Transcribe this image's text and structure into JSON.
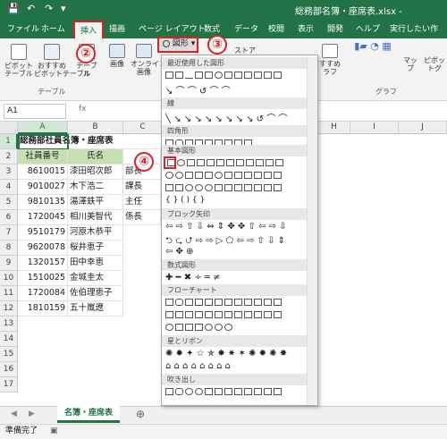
{
  "title_bar": {
    "title": "総務部名簿・座席表.xlsx - ",
    "save_icon": "save-icon",
    "undo": "↶",
    "redo": "↷",
    "menu": "▾"
  },
  "tabs": [
    {
      "label": "ファイル",
      "name": "tab-file"
    },
    {
      "label": "ホーム",
      "name": "tab-home"
    },
    {
      "label": "挿入",
      "name": "tab-insert"
    },
    {
      "label": "描画",
      "name": "tab-draw"
    },
    {
      "label": "ページ レイアウト",
      "name": "tab-page-layout"
    },
    {
      "label": "数式",
      "name": "tab-formulas"
    },
    {
      "label": "データ",
      "name": "tab-data"
    },
    {
      "label": "校閲",
      "name": "tab-review"
    },
    {
      "label": "表示",
      "name": "tab-view"
    },
    {
      "label": "開発",
      "name": "tab-developer"
    },
    {
      "label": "ヘルプ",
      "name": "tab-help"
    },
    {
      "label": "実行したい作",
      "name": "tell-me"
    }
  ],
  "ribbon": {
    "pivot": "ピボット\nテーブル",
    "rec_pivot": "おすすめ\nピボットテーブル",
    "table": "テーブル",
    "table_group": "テーブル",
    "image": "画像",
    "online_image": "オンライン\n画像",
    "shapes": "図形",
    "store": "ストア",
    "rec_chart": "すすめ\nラフ",
    "map": "マップ",
    "pivot_chart": "ピボットグ",
    "chart_group": "グラフ"
  },
  "badges": {
    "b2": "②",
    "b3": "③",
    "b4": "④"
  },
  "formula_bar": {
    "name_box": "A1",
    "fx": "fx"
  },
  "columns": [
    "A",
    "B",
    "C",
    "D",
    "E",
    "F",
    "G",
    "H",
    "I",
    "J"
  ],
  "rows": [
    "1",
    "2",
    "3",
    "4",
    "5",
    "6",
    "7",
    "8",
    "9",
    "10",
    "11",
    "12",
    "13",
    "14",
    "15",
    "16",
    "17"
  ],
  "sheet": {
    "title": "総務部社員名簿・座席表",
    "headers": [
      "社員番号",
      "氏名"
    ],
    "data": [
      [
        "8610015",
        "漆田昭次郎",
        "部長"
      ],
      [
        "9010027",
        "木下浩二",
        "課長"
      ],
      [
        "9810135",
        "湯澤鉄平",
        "主任"
      ],
      [
        "1720045",
        "相川美智代",
        "係長"
      ],
      [
        "9510179",
        "河原木恭平",
        ""
      ],
      [
        "9620078",
        "桜井恵子",
        ""
      ],
      [
        "1320157",
        "田中幸恵",
        ""
      ],
      [
        "1510025",
        "金城圭太",
        ""
      ],
      [
        "1720084",
        "佐伯理恵子",
        ""
      ],
      [
        "1810159",
        "五十嵐遼",
        ""
      ]
    ]
  },
  "sheet_tab": "名簿・座席表",
  "status": "準備完了",
  "gallery": {
    "sections": [
      "最近使用した図形",
      "線",
      "四角形",
      "基本図形",
      "ブロック矢印",
      "数式図形",
      "フローチャート",
      "星とリボン",
      "吹き出し"
    ]
  }
}
